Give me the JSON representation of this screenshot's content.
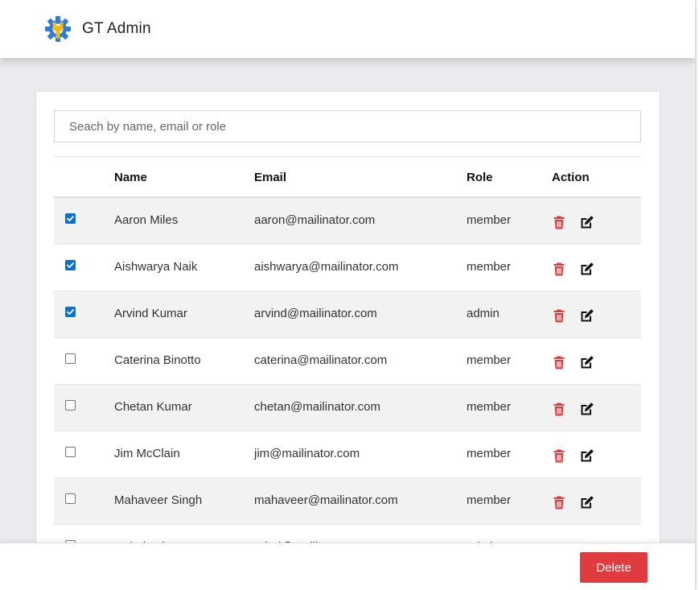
{
  "header": {
    "title": "GT Admin",
    "logo_icon": "gear-wrench-icon",
    "logo_colors": {
      "gear": "#2d7be0",
      "wrench": "#f2b90f"
    }
  },
  "search": {
    "placeholder": "Seach by name, email or role",
    "value": ""
  },
  "table": {
    "columns": [
      "Name",
      "Email",
      "Role",
      "Action"
    ],
    "rows": [
      {
        "checked": true,
        "name": "Aaron Miles",
        "email": "aaron@mailinator.com",
        "role": "member"
      },
      {
        "checked": true,
        "name": "Aishwarya Naik",
        "email": "aishwarya@mailinator.com",
        "role": "member"
      },
      {
        "checked": true,
        "name": "Arvind Kumar",
        "email": "arvind@mailinator.com",
        "role": "admin"
      },
      {
        "checked": false,
        "name": "Caterina Binotto",
        "email": "caterina@mailinator.com",
        "role": "member"
      },
      {
        "checked": false,
        "name": "Chetan Kumar",
        "email": "chetan@mailinator.com",
        "role": "member"
      },
      {
        "checked": false,
        "name": "Jim McClain",
        "email": "jim@mailinator.com",
        "role": "member"
      },
      {
        "checked": false,
        "name": "Mahaveer Singh",
        "email": "mahaveer@mailinator.com",
        "role": "member"
      },
      {
        "checked": false,
        "name": "Rahul Jain",
        "email": "rahul@mailinator.com",
        "role": "admin"
      }
    ],
    "action_icons": [
      "trash-icon",
      "edit-icon"
    ]
  },
  "footer": {
    "delete_label": "Delete"
  },
  "colors": {
    "delete": "#e03c3f",
    "trash": "#e03c3f",
    "checkbox_checked": "#0b6fd6",
    "row_stripe": "#f2f2f2",
    "page_background": "#e9ebee"
  }
}
